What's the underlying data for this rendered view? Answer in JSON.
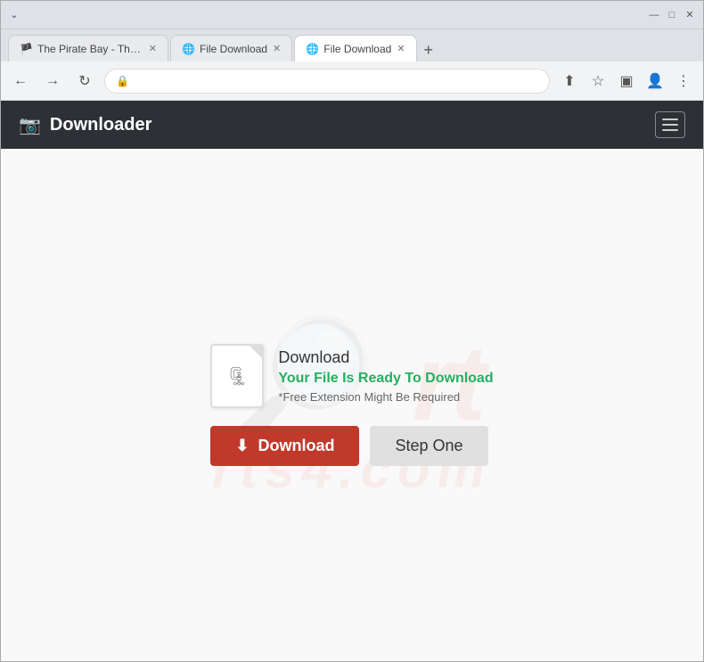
{
  "browser": {
    "tabs": [
      {
        "id": "tab1",
        "title": "The Pirate Bay - The…",
        "active": false,
        "favicon": "🏴"
      },
      {
        "id": "tab2",
        "title": "File Download",
        "active": false,
        "favicon": "🌐"
      },
      {
        "id": "tab3",
        "title": "File Download",
        "active": true,
        "favicon": "🌐"
      }
    ],
    "new_tab_label": "+",
    "nav": {
      "back": "←",
      "forward": "→",
      "refresh": "↻",
      "address": "",
      "lock_icon": "🔒"
    },
    "actions": {
      "share": "⬆",
      "star": "☆",
      "reader": "▣",
      "profile": "👤",
      "menu": "⋮"
    },
    "window_controls": {
      "minimize": "—",
      "maximize": "□",
      "close": "✕",
      "chevron": "⌄"
    }
  },
  "app": {
    "navbar": {
      "brand_icon": "📷",
      "brand_name": "Downloader",
      "hamburger_label": "Menu"
    }
  },
  "content": {
    "file_icon": "🗜",
    "download_label": "Download",
    "ready_text": "Your File Is Ready To Download",
    "note_text": "*Free Extension Might Be Required",
    "download_btn_icon": "⬇",
    "download_btn_label": "Download",
    "step_one_label": "Step One"
  },
  "watermark": {
    "top_text": "rt",
    "bottom_text": "rts4.com"
  }
}
